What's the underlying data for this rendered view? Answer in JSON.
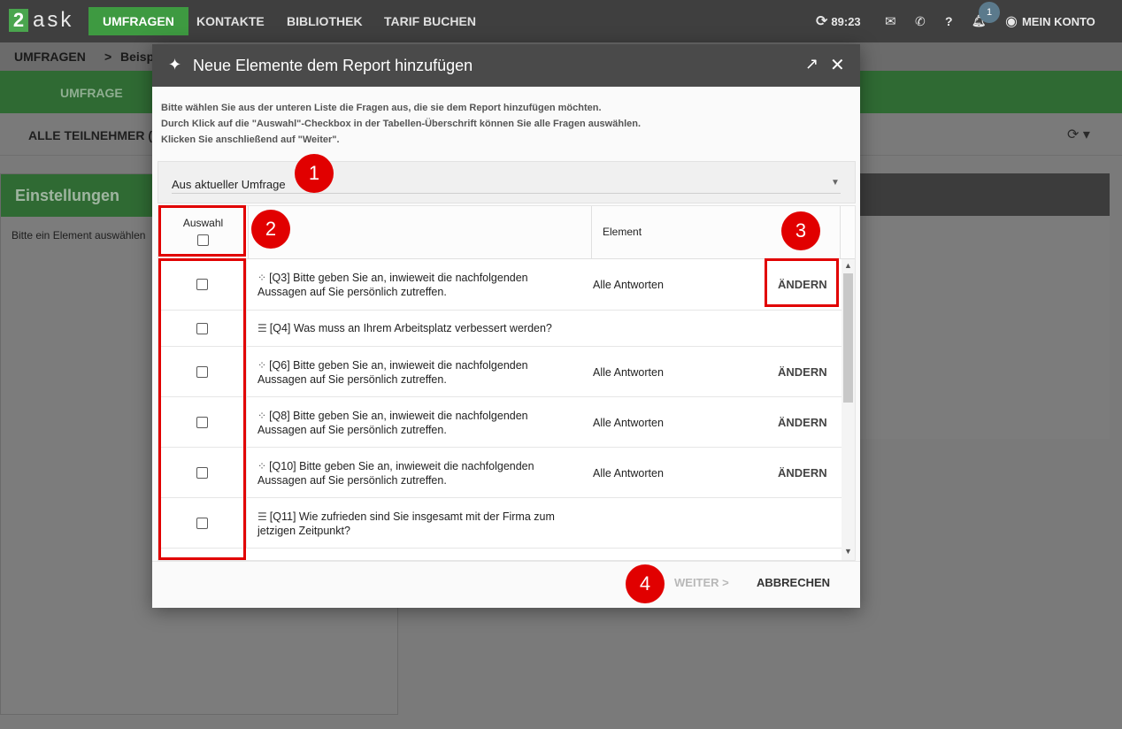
{
  "app": {
    "logo_digit": "2",
    "logo_text": "ask",
    "nav": [
      "UMFRAGEN",
      "KONTAKTE",
      "BIBLIOTHEK",
      "TARIF BUCHEN"
    ],
    "timer": "89:23",
    "notification_count": "1",
    "account_label": "MEIN KONTO",
    "breadcrumb_root": "UMFRAGEN",
    "breadcrumb_sep": ">",
    "breadcrumb_current": "Beisp",
    "subnav_tab": "UMFRAGE",
    "filter_label": "ALLE TEILNEHMER (IN",
    "settings_title": "Einstellungen",
    "settings_hint": "Bitte ein Element auswählen"
  },
  "modal": {
    "title": "Neue Elemente dem Report hinzufügen",
    "intro_lines": [
      "Bitte wählen Sie aus der unteren Liste die Fragen aus, die sie dem Report hinzufügen möchten.",
      "Durch Klick auf die \"Auswahl\"-Checkbox in der Tabellen-Überschrift können Sie alle Fragen auswählen.",
      "Klicken Sie anschließend auf \"Weiter\"."
    ],
    "source_select": "Aus aktueller Umfrage",
    "col_selection": "Auswahl",
    "col_element": "Element",
    "rows": [
      {
        "icon": "matrix",
        "question": "[Q3] Bitte geben Sie an, inwieweit die nachfolgenden Aussagen auf Sie persönlich zutreffen.",
        "element": "Alle Antworten",
        "action": "ÄNDERN"
      },
      {
        "icon": "list",
        "question": "[Q4] Was muss an Ihrem Arbeitsplatz verbessert werden?",
        "element": "",
        "action": ""
      },
      {
        "icon": "matrix",
        "question": "[Q6] Bitte geben Sie an, inwieweit die nachfolgenden Aussagen auf Sie persönlich zutreffen.",
        "element": "Alle Antworten",
        "action": "ÄNDERN"
      },
      {
        "icon": "matrix",
        "question": "[Q8] Bitte geben Sie an, inwieweit die nachfolgenden Aussagen auf Sie persönlich zutreffen.",
        "element": "Alle Antworten",
        "action": "ÄNDERN"
      },
      {
        "icon": "matrix",
        "question": "[Q10] Bitte geben Sie an, inwieweit die nachfolgenden Aussagen auf Sie persönlich zutreffen.",
        "element": "Alle Antworten",
        "action": "ÄNDERN"
      },
      {
        "icon": "list",
        "question": "[Q11] Wie zufrieden sind Sie insgesamt mit der Firma zum jetzigen Zeitpunkt?",
        "element": "",
        "action": ""
      }
    ],
    "btn_next": "WEITER >",
    "btn_cancel": "ABBRECHEN"
  },
  "annotations": {
    "markers": [
      "1",
      "2",
      "3",
      "4"
    ],
    "color": "#e10000"
  },
  "colors": {
    "brand_green": "#4aa54e",
    "topbar": "#3f3f3f",
    "modal_header": "#4a4a4a"
  }
}
